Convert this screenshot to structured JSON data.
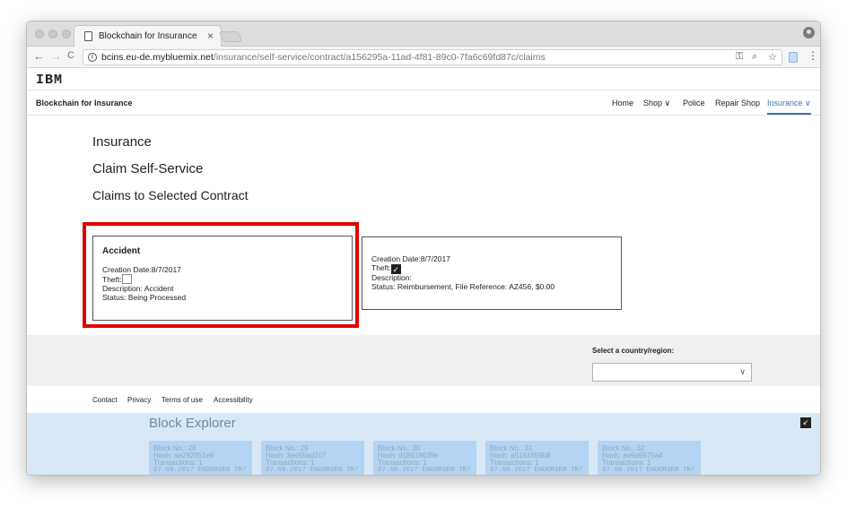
{
  "browser": {
    "tab_title": "Blockchain for Insurance",
    "tab_close": "×",
    "url_host": "bcins.eu-de.mybluemix.net",
    "url_path": "/insurance/self-service/contract/a156295a-11ad-4f81-89c0-7fa6c69fd87c/claims",
    "nav_back": "←",
    "nav_forward": "→",
    "nav_reload": "C",
    "icon_key": "key-icon",
    "icon_zoom": "zoom-icon",
    "icon_star": "star-icon"
  },
  "site": {
    "logo": "IBM",
    "brand": "Blockchain for Insurance",
    "nav": [
      {
        "label": "Home"
      },
      {
        "label": "Shop ∨"
      },
      {
        "label": "Police"
      },
      {
        "label": "Repair Shop"
      },
      {
        "label": "Insurance ∨"
      }
    ]
  },
  "main": {
    "title": "Insurance",
    "subtitle": "Claim Self-Service",
    "section": "Claims to Selected Contract",
    "claims": [
      {
        "title": "Accident",
        "creation_date": "Creation Date:8/7/2017",
        "theft_label": "Theft:",
        "theft_checked": false,
        "description": "Description: Accident",
        "status": "Status: Being Processed"
      },
      {
        "title": "",
        "creation_date": "Creation Date:8/7/2017",
        "theft_label": "Theft:",
        "theft_checked": true,
        "description": "Description:",
        "status": "Status: Reimbursement, File Reference: AZ456, $0.00"
      }
    ]
  },
  "country": {
    "label": "Select a country/region:",
    "value": ""
  },
  "footer": {
    "links": [
      "Contact",
      "Privacy",
      "Terms of use",
      "Accessibility"
    ]
  },
  "explorer": {
    "title": "Block Explorer",
    "blocks": [
      {
        "no": "Block No.: 28",
        "hash": "Hash: ae292951e6",
        "tx": "Transactions: 1",
        "entry": "07.08.2017 ENDORSER TR/"
      },
      {
        "no": "Block No.: 29",
        "hash": "Hash: 3ee55ad2c7",
        "tx": "Transactions: 1",
        "entry": "07.08.2017 ENDORSER TR/"
      },
      {
        "no": "Block No.: 30",
        "hash": "Hash: d18619639e",
        "tx": "Transactions: 1",
        "entry": "07.08.2017 ENDORSER TR/"
      },
      {
        "no": "Block No.: 31",
        "hash": "Hash: a5161659b8",
        "tx": "Transactions: 1",
        "entry": "07.08.2017 ENDORSER TR/"
      },
      {
        "no": "Block No.: 32",
        "hash": "Hash: aa9a9975a4",
        "tx": "Transactions: 1",
        "entry": "07.08.2017 ENDORSER TR/"
      }
    ]
  }
}
